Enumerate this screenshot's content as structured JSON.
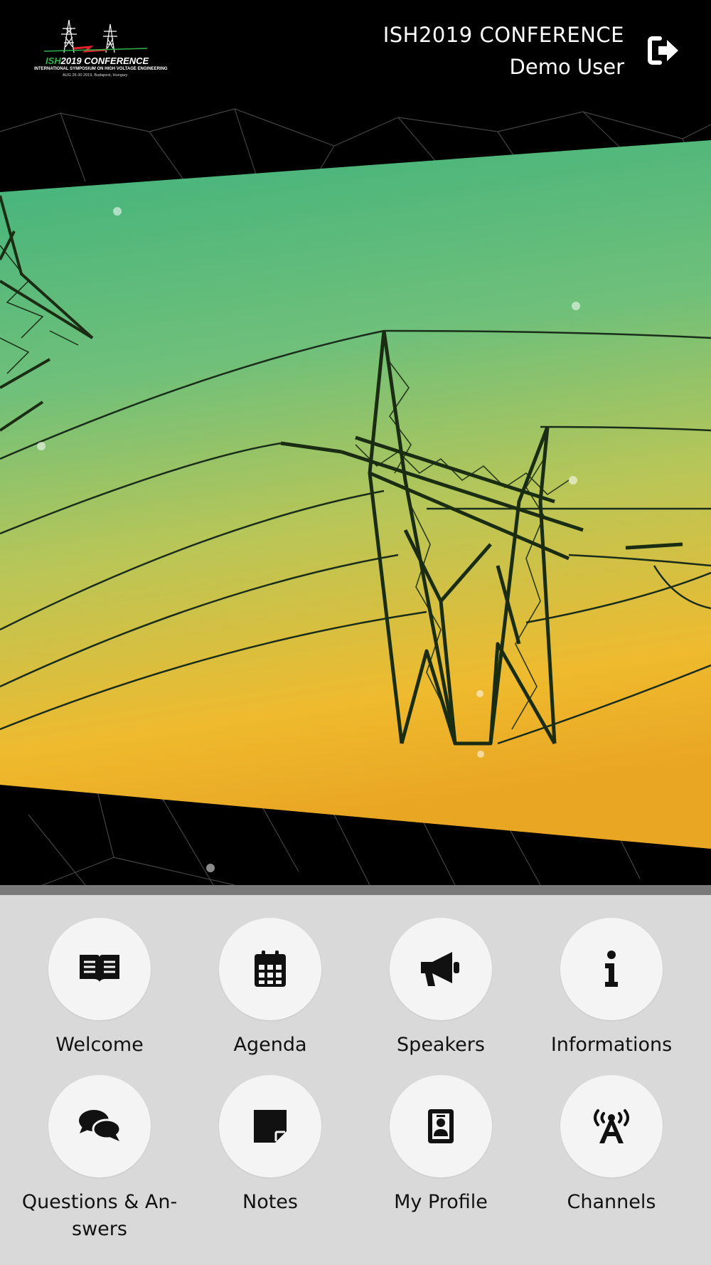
{
  "header": {
    "logo": {
      "title_green": "ISH",
      "title_white": "2019 CONFERENCE",
      "subtitle": "INTERNATIONAL SYMPOSIUM ON HIGH VOLTAGE ENGINEERING",
      "date": "AUG 26-30 2019, Budapest, Hungary"
    },
    "conference_title": "ISH2019 CONFERENCE",
    "user_name": "Demo User",
    "logout_icon": "sign-out-icon"
  },
  "hero": {
    "image": "power-transmission-tower-sky",
    "colors": {
      "sky_top": "#4ab883",
      "sky_mid": "#9bc760",
      "sky_bottom": "#f0b82c"
    }
  },
  "menu": {
    "items": [
      {
        "label": "Welcome",
        "icon": "book-open-icon"
      },
      {
        "label": "Agenda",
        "icon": "calendar-icon"
      },
      {
        "label": "Speakers",
        "icon": "megaphone-icon"
      },
      {
        "label": "Informations",
        "icon": "info-icon"
      },
      {
        "label": "Questions & An-",
        "label_line2": "swers",
        "icon": "comments-icon"
      },
      {
        "label": "Notes",
        "icon": "sticky-note-icon"
      },
      {
        "label": "My Profile",
        "icon": "id-badge-icon"
      },
      {
        "label": "Channels",
        "icon": "broadcast-tower-icon"
      }
    ]
  }
}
